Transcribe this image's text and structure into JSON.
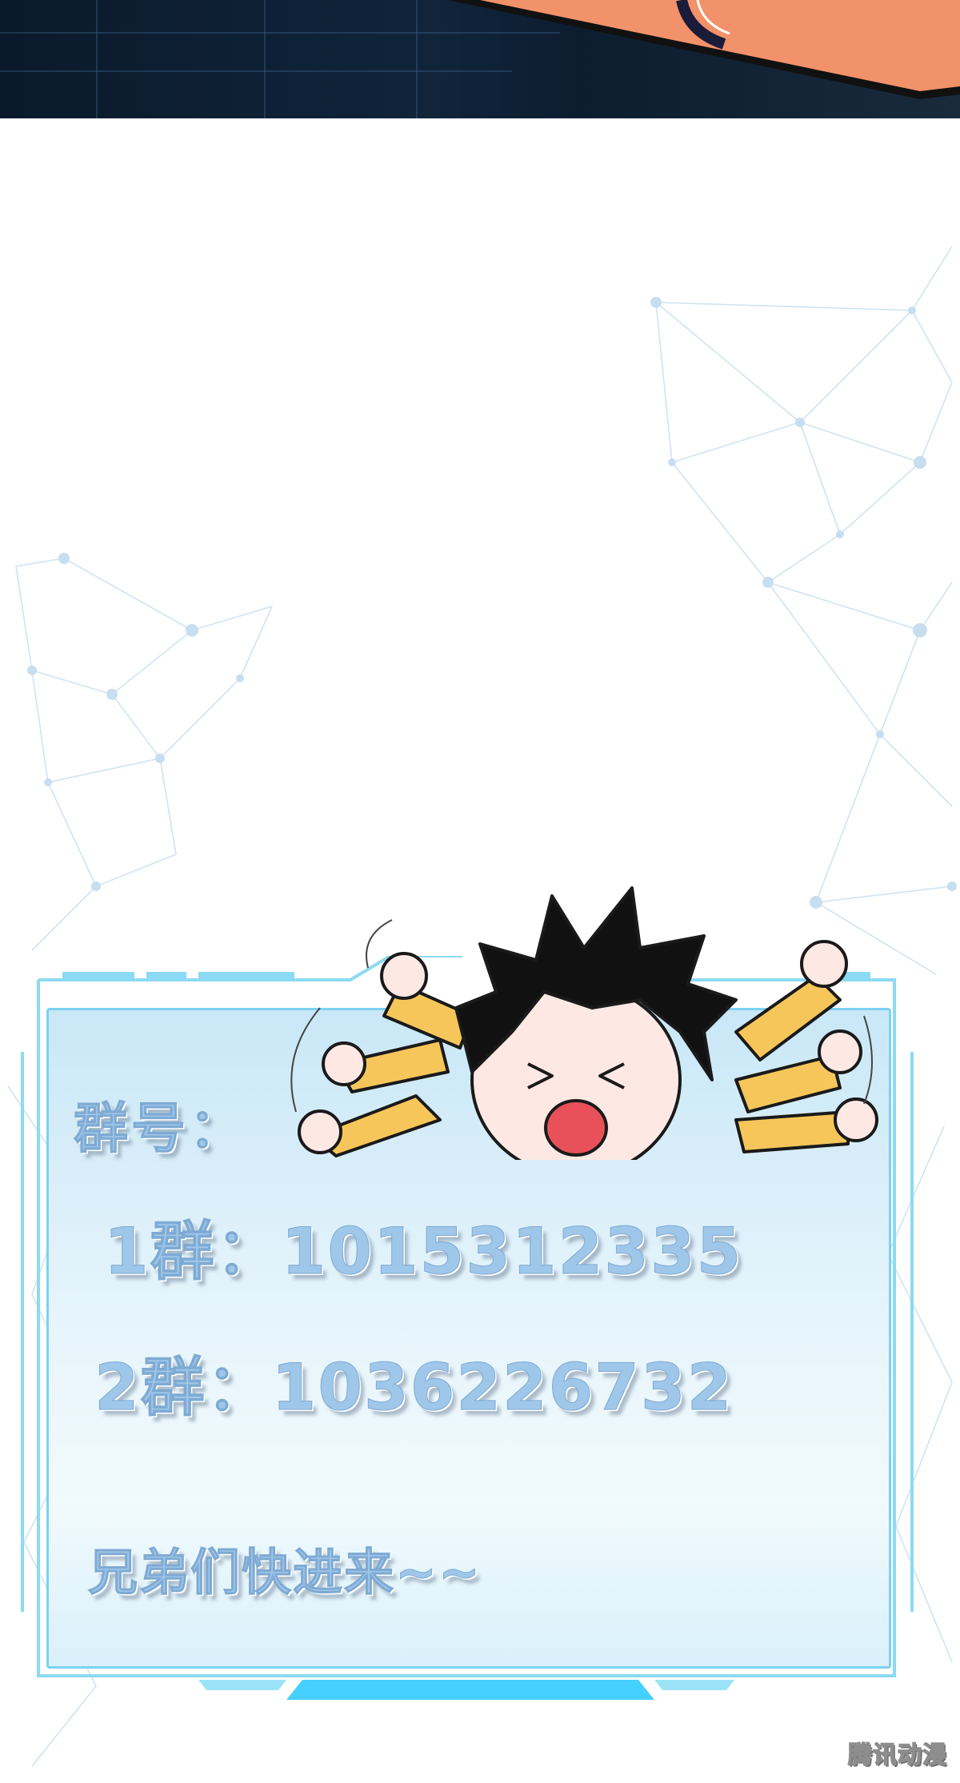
{
  "panel": {
    "heading": "群号：",
    "group_1": "1群：1015312335",
    "group_2": "2群：1036226732",
    "invite": "兄弟们快进来~~"
  },
  "watermark": "腾讯动漫",
  "colors": {
    "text_blue": "#9fc7ea",
    "frame_blue": "#7dd1f0",
    "top_banner": "#0a1a2c",
    "orange_band": "#f2926a"
  }
}
